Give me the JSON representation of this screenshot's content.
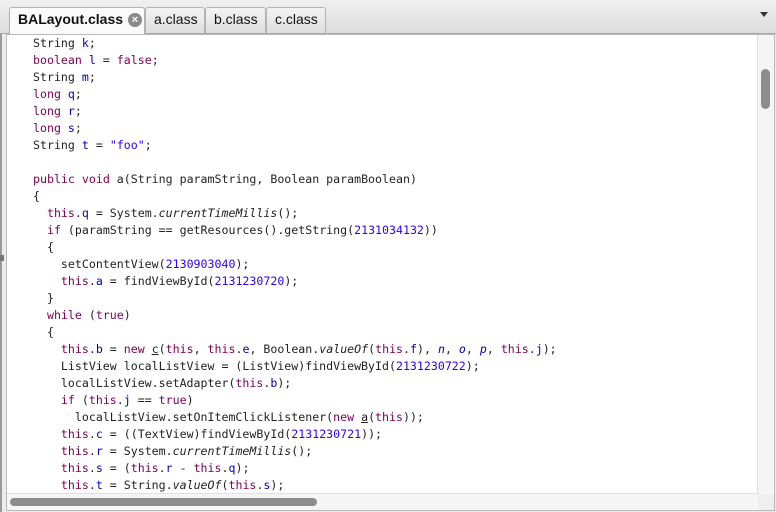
{
  "tabs": [
    {
      "label": "BALayout.class",
      "active": true
    },
    {
      "label": "a.class"
    },
    {
      "label": "b.class"
    },
    {
      "label": "c.class"
    }
  ],
  "code_lines": [
    [
      {
        "t": "String "
      },
      {
        "t": "k",
        "c": "fld"
      },
      {
        "t": ";"
      }
    ],
    [
      {
        "t": "boolean ",
        "c": "kw"
      },
      {
        "t": "l",
        "c": "fld"
      },
      {
        "t": " = "
      },
      {
        "t": "false",
        "c": "kw"
      },
      {
        "t": ";"
      }
    ],
    [
      {
        "t": "String "
      },
      {
        "t": "m",
        "c": "fld"
      },
      {
        "t": ";"
      }
    ],
    [
      {
        "t": "long ",
        "c": "kw"
      },
      {
        "t": "q",
        "c": "fld"
      },
      {
        "t": ";"
      }
    ],
    [
      {
        "t": "long ",
        "c": "kw"
      },
      {
        "t": "r",
        "c": "fld"
      },
      {
        "t": ";"
      }
    ],
    [
      {
        "t": "long ",
        "c": "kw"
      },
      {
        "t": "s",
        "c": "fld"
      },
      {
        "t": ";"
      }
    ],
    [
      {
        "t": "String "
      },
      {
        "t": "t",
        "c": "fld"
      },
      {
        "t": " = "
      },
      {
        "t": "\"foo\"",
        "c": "str"
      },
      {
        "t": ";"
      }
    ],
    [],
    [
      {
        "t": "public ",
        "c": "kw"
      },
      {
        "t": "void ",
        "c": "kw"
      },
      {
        "t": "a(String paramString, Boolean paramBoolean)"
      }
    ],
    [
      {
        "t": "{"
      }
    ],
    [
      {
        "t": "  "
      },
      {
        "t": "this",
        "c": "kw"
      },
      {
        "t": "."
      },
      {
        "t": "q",
        "c": "fld"
      },
      {
        "t": " = System."
      },
      {
        "t": "currentTimeMillis",
        "c": "it"
      },
      {
        "t": "();"
      }
    ],
    [
      {
        "t": "  "
      },
      {
        "t": "if",
        "c": "kw"
      },
      {
        "t": " (paramString == getResources().getString("
      },
      {
        "t": "2131034132",
        "c": "num"
      },
      {
        "t": "))"
      }
    ],
    [
      {
        "t": "  {"
      }
    ],
    [
      {
        "t": "    setContentView("
      },
      {
        "t": "2130903040",
        "c": "num"
      },
      {
        "t": ");"
      }
    ],
    [
      {
        "t": "    "
      },
      {
        "t": "this",
        "c": "kw"
      },
      {
        "t": "."
      },
      {
        "t": "a",
        "c": "fld"
      },
      {
        "t": " = findViewById("
      },
      {
        "t": "2131230720",
        "c": "num"
      },
      {
        "t": ");"
      }
    ],
    [
      {
        "t": "  }"
      }
    ],
    [
      {
        "t": "  "
      },
      {
        "t": "while",
        "c": "kw"
      },
      {
        "t": " ("
      },
      {
        "t": "true",
        "c": "kw"
      },
      {
        "t": ")"
      }
    ],
    [
      {
        "t": "  {"
      }
    ],
    [
      {
        "t": "    "
      },
      {
        "t": "this",
        "c": "kw"
      },
      {
        "t": "."
      },
      {
        "t": "b",
        "c": "fld"
      },
      {
        "t": " = "
      },
      {
        "t": "new ",
        "c": "kw"
      },
      {
        "t": "c",
        "c": "ul"
      },
      {
        "t": "("
      },
      {
        "t": "this",
        "c": "kw"
      },
      {
        "t": ", "
      },
      {
        "t": "this",
        "c": "kw"
      },
      {
        "t": "."
      },
      {
        "t": "e",
        "c": "fld"
      },
      {
        "t": ", Boolean."
      },
      {
        "t": "valueOf",
        "c": "it"
      },
      {
        "t": "("
      },
      {
        "t": "this",
        "c": "kw"
      },
      {
        "t": "."
      },
      {
        "t": "f",
        "c": "fld"
      },
      {
        "t": "), "
      },
      {
        "t": "n",
        "c": "fld it"
      },
      {
        "t": ", "
      },
      {
        "t": "o",
        "c": "fld it"
      },
      {
        "t": ", "
      },
      {
        "t": "p",
        "c": "fld it"
      },
      {
        "t": ", "
      },
      {
        "t": "this",
        "c": "kw"
      },
      {
        "t": "."
      },
      {
        "t": "j",
        "c": "fld"
      },
      {
        "t": ");"
      }
    ],
    [
      {
        "t": "    ListView localListView = (ListView)findViewById("
      },
      {
        "t": "2131230722",
        "c": "num"
      },
      {
        "t": ");"
      }
    ],
    [
      {
        "t": "    localListView.setAdapter("
      },
      {
        "t": "this",
        "c": "kw"
      },
      {
        "t": "."
      },
      {
        "t": "b",
        "c": "fld"
      },
      {
        "t": ");"
      }
    ],
    [
      {
        "t": "    "
      },
      {
        "t": "if",
        "c": "kw"
      },
      {
        "t": " ("
      },
      {
        "t": "this",
        "c": "kw"
      },
      {
        "t": "."
      },
      {
        "t": "j",
        "c": "fld"
      },
      {
        "t": " == "
      },
      {
        "t": "true",
        "c": "kw"
      },
      {
        "t": ")"
      }
    ],
    [
      {
        "t": "      localListView.setOnItemClickListener("
      },
      {
        "t": "new ",
        "c": "kw"
      },
      {
        "t": "a",
        "c": "ul"
      },
      {
        "t": "("
      },
      {
        "t": "this",
        "c": "kw"
      },
      {
        "t": "));"
      }
    ],
    [
      {
        "t": "    "
      },
      {
        "t": "this",
        "c": "kw"
      },
      {
        "t": "."
      },
      {
        "t": "c",
        "c": "fld"
      },
      {
        "t": " = ((TextView)findViewById("
      },
      {
        "t": "2131230721",
        "c": "num"
      },
      {
        "t": "));"
      }
    ],
    [
      {
        "t": "    "
      },
      {
        "t": "this",
        "c": "kw"
      },
      {
        "t": "."
      },
      {
        "t": "r",
        "c": "fld"
      },
      {
        "t": " = System."
      },
      {
        "t": "currentTimeMillis",
        "c": "it"
      },
      {
        "t": "();"
      }
    ],
    [
      {
        "t": "    "
      },
      {
        "t": "this",
        "c": "kw"
      },
      {
        "t": "."
      },
      {
        "t": "s",
        "c": "fld"
      },
      {
        "t": " = ("
      },
      {
        "t": "this",
        "c": "kw"
      },
      {
        "t": "."
      },
      {
        "t": "r",
        "c": "fld"
      },
      {
        "t": " - "
      },
      {
        "t": "this",
        "c": "kw"
      },
      {
        "t": "."
      },
      {
        "t": "q",
        "c": "fld"
      },
      {
        "t": ");"
      }
    ],
    [
      {
        "t": "    "
      },
      {
        "t": "this",
        "c": "kw"
      },
      {
        "t": "."
      },
      {
        "t": "t",
        "c": "fld"
      },
      {
        "t": " = String."
      },
      {
        "t": "valueOf",
        "c": "it"
      },
      {
        "t": "("
      },
      {
        "t": "this",
        "c": "kw"
      },
      {
        "t": "."
      },
      {
        "t": "s",
        "c": "fld"
      },
      {
        "t": ");"
      }
    ]
  ],
  "icons": {
    "tab_close": "close-circle-icon",
    "tab_menu": "chevron-down-icon"
  },
  "colors": {
    "keyword": "#7f0055",
    "field": "#0000c0",
    "number": "#2a00ff",
    "string": "#2a00ff"
  }
}
